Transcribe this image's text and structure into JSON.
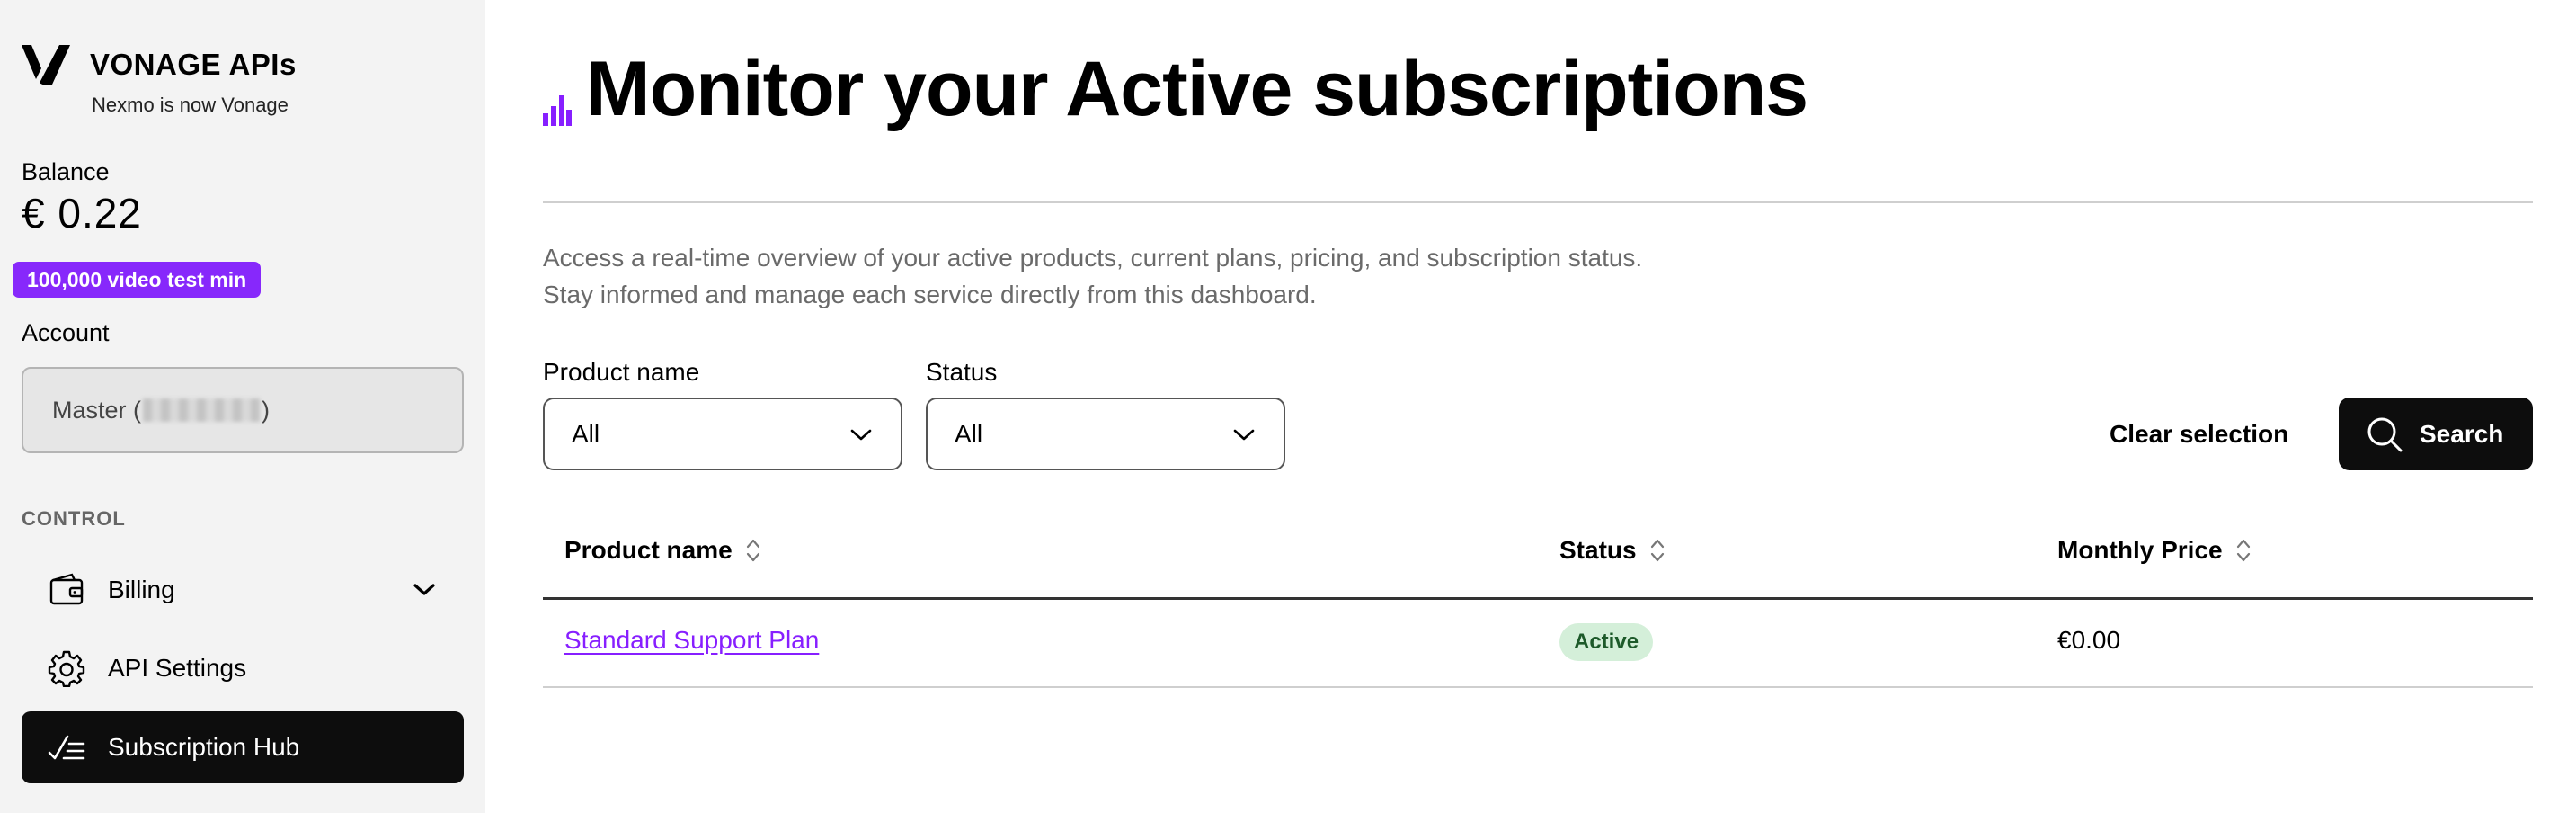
{
  "brand": {
    "name": "VONAGE APIs",
    "subtitle": "Nexmo is now Vonage"
  },
  "balance": {
    "label": "Balance",
    "value": "€ 0.22",
    "promo": "100,000 video test min"
  },
  "account": {
    "label": "Account",
    "prefix": "Master (",
    "suffix": ")"
  },
  "sidebar": {
    "section_label": "CONTROL",
    "items": [
      {
        "label": "Billing",
        "icon": "wallet-icon",
        "expandable": true
      },
      {
        "label": "API Settings",
        "icon": "gear-icon"
      },
      {
        "label": "Subscription Hub",
        "icon": "checklist-icon",
        "active": true
      }
    ]
  },
  "page": {
    "title": "Monitor your Active subscriptions",
    "description_line1": "Access a real-time overview of your active products, current plans, pricing, and subscription status.",
    "description_line2": "Stay informed and manage each service directly from this dashboard."
  },
  "filters": {
    "product": {
      "label": "Product name",
      "value": "All"
    },
    "status": {
      "label": "Status",
      "value": "All"
    },
    "clear_label": "Clear selection",
    "search_label": "Search"
  },
  "table": {
    "columns": [
      "Product name",
      "Status",
      "Monthly Price"
    ],
    "rows": [
      {
        "product": "Standard Support Plan",
        "status": "Active",
        "price": "€0.00"
      }
    ]
  },
  "colors": {
    "accent": "#871fff",
    "promo_badge": "#8728fb",
    "active_badge_bg": "#d4efd9",
    "nav_active_bg": "#0d0d0d"
  }
}
